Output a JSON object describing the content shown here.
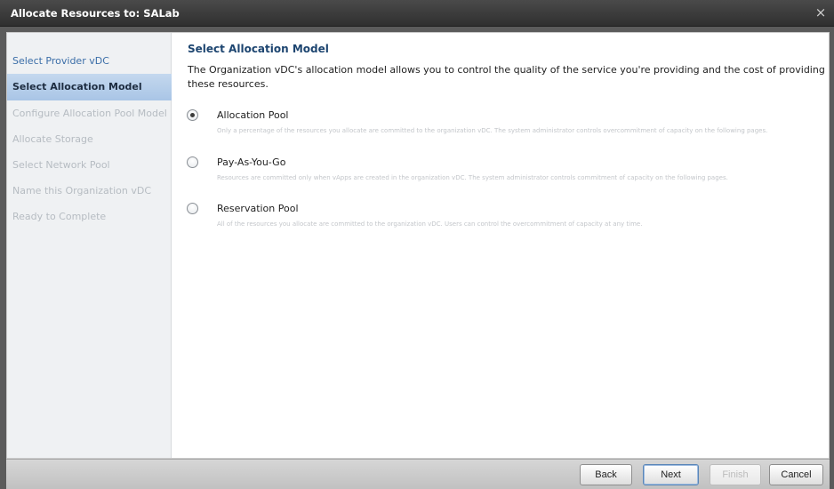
{
  "window": {
    "title": "Allocate Resources to: SALab",
    "close_glyph": "×"
  },
  "sidebar": {
    "steps": [
      {
        "label": "Select Provider vDC",
        "state": "done"
      },
      {
        "label": "Select Allocation Model",
        "state": "active"
      },
      {
        "label": "Configure Allocation Pool Model",
        "state": "todo"
      },
      {
        "label": "Allocate Storage",
        "state": "todo"
      },
      {
        "label": "Select Network Pool",
        "state": "todo"
      },
      {
        "label": "Name this Organization vDC",
        "state": "todo"
      },
      {
        "label": "Ready to Complete",
        "state": "todo"
      }
    ]
  },
  "main": {
    "heading": "Select Allocation Model",
    "description": "The Organization vDC's allocation model allows you to control the quality of the service you're providing and the cost of providing these resources.",
    "options": [
      {
        "label": "Allocation Pool",
        "selected": true,
        "description": "Only a percentage of the resources you allocate are committed to the organization vDC. The system administrator controls overcommitment of capacity on the following pages."
      },
      {
        "label": "Pay-As-You-Go",
        "selected": false,
        "description": "Resources are committed only when vApps are created in the organization vDC. The system administrator controls commitment of capacity on the following pages."
      },
      {
        "label": "Reservation Pool",
        "selected": false,
        "description": "All of the resources you allocate are committed to the organization vDC. Users can control the overcommitment of capacity at any time."
      }
    ]
  },
  "footer": {
    "back_label": "Back",
    "next_label": "Next",
    "finish_label": "Finish",
    "cancel_label": "Cancel"
  },
  "colors": {
    "titlebar": "#3a3a3a",
    "sidebar_bg": "#eff1f3",
    "active_step": "#b6cdea",
    "link_blue": "#3b6ea8",
    "heading_blue": "#1d4570"
  }
}
